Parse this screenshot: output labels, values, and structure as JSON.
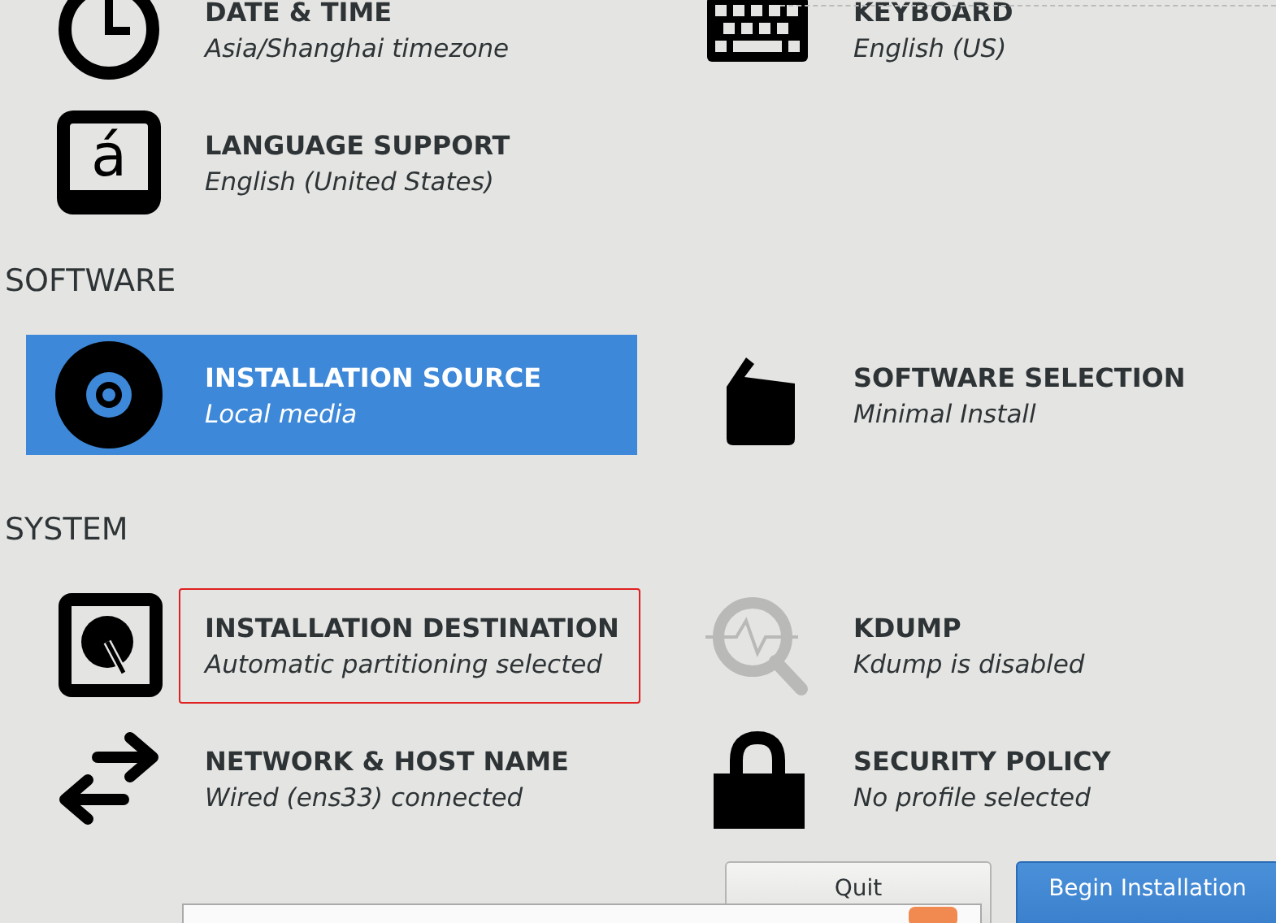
{
  "sections": [
    {
      "items": [
        {
          "kind": "clock",
          "title": "DATE & TIME",
          "status": "Asia/Shanghai timezone",
          "selected": false,
          "outlined": false
        },
        {
          "kind": "keyboard",
          "title": "KEYBOARD",
          "status": "English (US)",
          "selected": false,
          "outlined": false
        },
        {
          "kind": "language",
          "glyph": "á",
          "title": "LANGUAGE SUPPORT",
          "status": "English (United States)",
          "selected": false,
          "outlined": false
        }
      ]
    },
    {
      "heading": "SOFTWARE",
      "items": [
        {
          "kind": "disc",
          "title": "INSTALLATION SOURCE",
          "status": "Local media",
          "selected": true,
          "outlined": false
        },
        {
          "kind": "package",
          "title": "SOFTWARE SELECTION",
          "status": "Minimal Install",
          "selected": false,
          "outlined": false
        }
      ]
    },
    {
      "heading": "SYSTEM",
      "items": [
        {
          "kind": "disk",
          "title": "INSTALLATION DESTINATION",
          "status": "Automatic partitioning selected",
          "selected": false,
          "outlined": true
        },
        {
          "kind": "kdump",
          "title": "KDUMP",
          "status": "Kdump is disabled",
          "selected": false,
          "outlined": false
        },
        {
          "kind": "network",
          "title": "NETWORK & HOST NAME",
          "status": "Wired (ens33) connected",
          "selected": false,
          "outlined": false
        },
        {
          "kind": "lock",
          "title": "SECURITY POLICY",
          "status": "No profile selected",
          "selected": false,
          "outlined": false
        }
      ]
    }
  ],
  "buttons": [
    {
      "label": "Quit",
      "kind": "secondary"
    },
    {
      "label": "Begin Installation",
      "kind": "primary"
    }
  ]
}
